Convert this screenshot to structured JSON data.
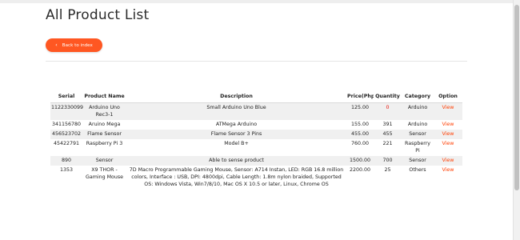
{
  "page": {
    "title": "All Product List",
    "back_button_label": "Back to index",
    "back_icon": "chevron-left-icon"
  },
  "colors": {
    "accent": "#ff5722",
    "link": "#ff3d00",
    "zero_quantity": "#e8140a"
  },
  "table": {
    "headers": [
      "Serial",
      "Product Name",
      "Description",
      "Price(Php)",
      "Quantity",
      "Category",
      "Option"
    ],
    "rows": [
      {
        "serial": "1122330099",
        "name": "Arduino Uno Rec3-1",
        "description": "Small Arduino Uno Blue",
        "price": "125.00",
        "quantity": "0",
        "category": "Arduino",
        "option": "View"
      },
      {
        "serial": "341156780",
        "name": "Aruino Mega",
        "description": "ATMega Arduino",
        "price": "155.00",
        "quantity": "391",
        "category": "Arduino",
        "option": "View"
      },
      {
        "serial": "456523702",
        "name": "Flame Sensor",
        "description": "Flame Sensor 3 Pins",
        "price": "455.00",
        "quantity": "455",
        "category": "Sensor",
        "option": "View"
      },
      {
        "serial": "45422791",
        "name": "Raspberry Pi 3",
        "description": "Model B+",
        "price": "760.00",
        "quantity": "221",
        "category": "Raspberry Pi",
        "option": "View"
      },
      {
        "serial": "890",
        "name": "Sensor",
        "description": "Able to sense product",
        "price": "1500.00",
        "quantity": "700",
        "category": "Sensor",
        "option": "View"
      },
      {
        "serial": "1353",
        "name": "X9 THOR - Gaming Mouse",
        "description": "7D Macro Programmable Gaming Mouse, Sensor: A714 Instan, LED: RGB 16.8 million colors, Interface : USB, DPI: 4800dpi, Cable Length: 1.8m nylon braided, Supported OS: Windows Vista, Win7/8/10, Mac OS X 10.5 or later, Linux, Chrome OS",
        "price": "2200.00",
        "quantity": "25",
        "category": "Others",
        "option": "View"
      }
    ]
  }
}
